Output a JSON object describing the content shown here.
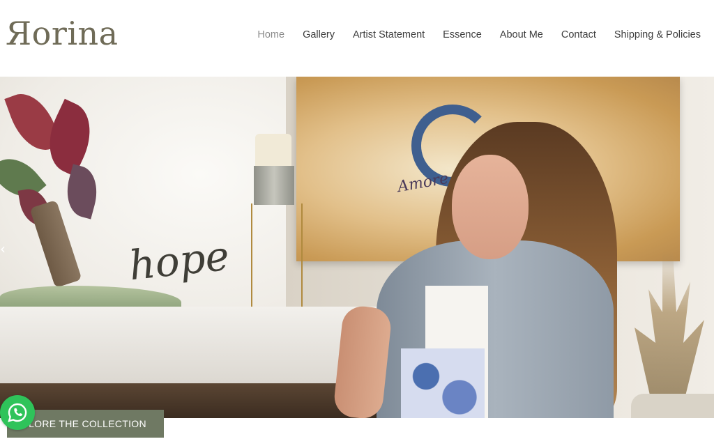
{
  "site": {
    "logo": "Яorina"
  },
  "nav": {
    "items": [
      {
        "label": "Home",
        "active": true
      },
      {
        "label": "Gallery"
      },
      {
        "label": "Artist Statement"
      },
      {
        "label": "Essence"
      },
      {
        "label": "About Me"
      },
      {
        "label": "Contact"
      },
      {
        "label": "Shipping & Policies"
      }
    ]
  },
  "hero": {
    "painting_left_text": "hope",
    "painting_right_text": "Amore",
    "prev_arrow_icon": "chevron-left-icon",
    "cta_label": "LORE THE COLLECTION"
  },
  "whatsapp": {
    "icon": "whatsapp-icon",
    "color": "#2fc35a"
  },
  "colors": {
    "brand": "#6f6b57",
    "cta_bg": "#6f7963",
    "nav_text": "#3d3d3d",
    "nav_active": "#8a8a8a"
  }
}
